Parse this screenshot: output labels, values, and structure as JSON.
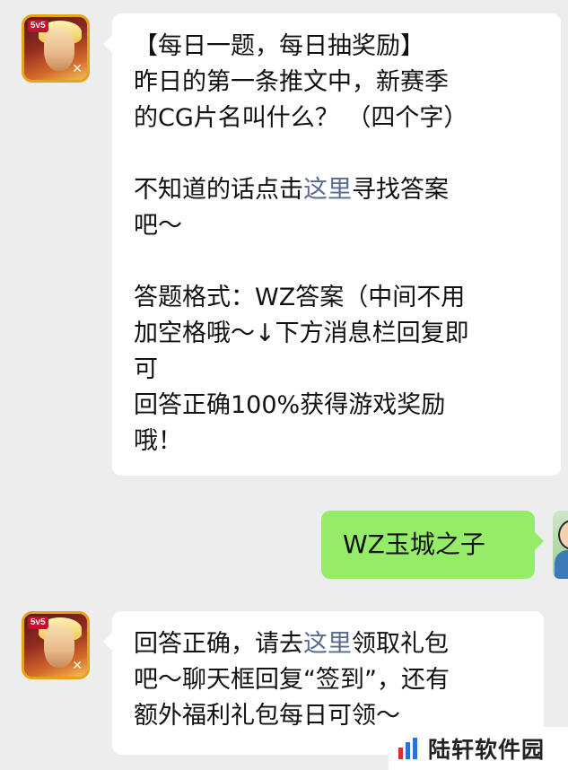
{
  "messages": [
    {
      "sender": "bot",
      "lines": [
        [
          "【每日一题，每日抽奖励】"
        ],
        [
          "昨日的第一条推文中，新赛季"
        ],
        [
          "的CG片名叫什么？ （四个字）"
        ],
        [
          ""
        ],
        [
          "不知道的话点击",
          {
            "link": "这里"
          },
          "寻找答案"
        ],
        [
          "吧～"
        ],
        [
          ""
        ],
        [
          "答题格式：WZ答案（中间不用"
        ],
        [
          "加空格哦～↓下方消息栏回复即"
        ],
        [
          "可"
        ],
        [
          "回答正确100%获得游戏奖励"
        ],
        [
          "哦！"
        ]
      ]
    },
    {
      "sender": "user",
      "text": "WZ玉城之子"
    },
    {
      "sender": "bot",
      "lines": [
        [
          "回答正确，请去",
          {
            "link": "这里"
          },
          "领取礼包"
        ],
        [
          "吧～聊天框回复“签到”，还有"
        ],
        [
          "额外福利礼包每日可领～"
        ]
      ]
    }
  ],
  "bot_avatar": {
    "badge": "5v5",
    "icon": "hero-avatar-icon"
  },
  "user_avatar": {
    "icon": "user-avatar-icon"
  },
  "watermark": {
    "text": "陆轩软件园",
    "icon": "bar-chart-logo-icon"
  },
  "colors": {
    "background": "#ededed",
    "bot_bubble": "#ffffff",
    "user_bubble": "#95ec69",
    "link": "#576b95"
  }
}
